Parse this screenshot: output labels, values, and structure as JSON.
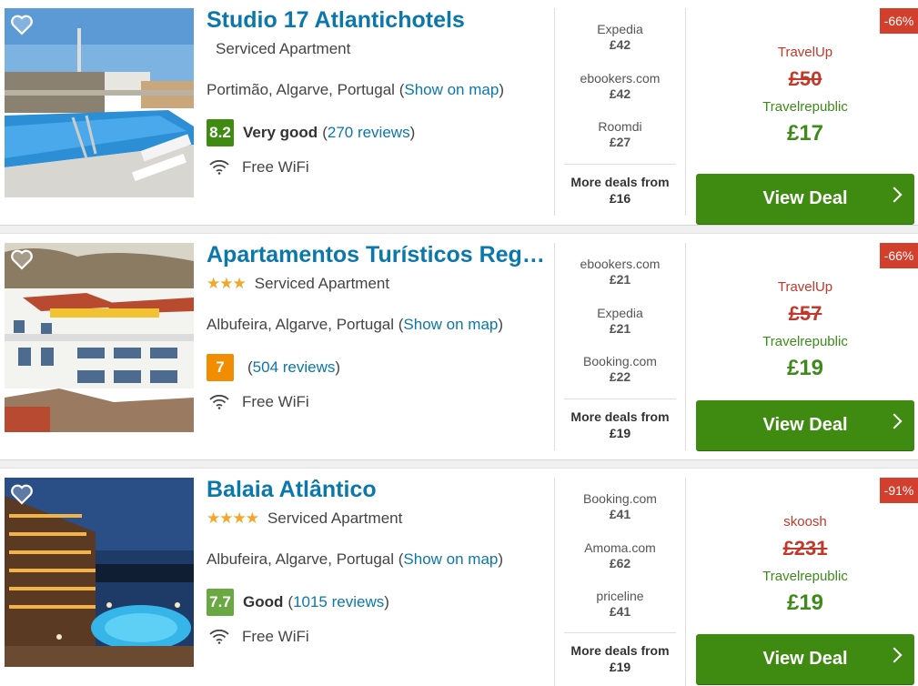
{
  "hotels": [
    {
      "name": "Studio 17 Atlantichotels",
      "stars": "",
      "type": "Serviced Apartment",
      "location": "Portimão, Algarve, Portugal",
      "map_open": "(",
      "map_link": "Show on map",
      "map_close": ")",
      "score": "8.2",
      "score_color": "#3f8b12",
      "rating_label": "Very good",
      "reviews_open": "(",
      "reviews_link": "270 reviews",
      "reviews_close": ")",
      "amenity": "Free WiFi",
      "deals": [
        {
          "provider": "Expedia",
          "price": "£42"
        },
        {
          "provider": "ebookers.com",
          "price": "£42"
        },
        {
          "provider": "Roomdi",
          "price": "£27"
        }
      ],
      "more_deals_label": "More deals from",
      "more_deals_price": "£16",
      "discount": "-66%",
      "old_provider": "TravelUp",
      "old_price": "£50",
      "best_provider": "Travelrepublic",
      "best_price": "£17",
      "cta": "View Deal"
    },
    {
      "name": "Apartamentos Turísticos Reg…",
      "stars": "★★★",
      "type": "Serviced Apartment",
      "location": "Albufeira, Algarve, Portugal",
      "map_open": "(",
      "map_link": "Show on map",
      "map_close": ")",
      "score": "7",
      "score_color": "#f28c00",
      "rating_label": "",
      "reviews_open": "(",
      "reviews_link": "504 reviews",
      "reviews_close": ")",
      "amenity": "Free WiFi",
      "deals": [
        {
          "provider": "ebookers.com",
          "price": "£21"
        },
        {
          "provider": "Expedia",
          "price": "£21"
        },
        {
          "provider": "Booking.com",
          "price": "£22"
        }
      ],
      "more_deals_label": "More deals from",
      "more_deals_price": "£19",
      "discount": "-66%",
      "old_provider": "TravelUp",
      "old_price": "£57",
      "best_provider": "Travelrepublic",
      "best_price": "£19",
      "cta": "View Deal"
    },
    {
      "name": "Balaia Atlântico",
      "stars": "★★★★",
      "type": "Serviced Apartment",
      "location": "Albufeira, Algarve, Portugal",
      "map_open": "(",
      "map_link": "Show on map",
      "map_close": ")",
      "score": "7.7",
      "score_color": "#6aa844",
      "rating_label": "Good",
      "reviews_open": "(",
      "reviews_link": "1015 reviews",
      "reviews_close": ")",
      "amenity": "Free WiFi",
      "deals": [
        {
          "provider": "Booking.com",
          "price": "£41"
        },
        {
          "provider": "Amoma.com",
          "price": "£62"
        },
        {
          "provider": "priceline",
          "price": "£41"
        }
      ],
      "more_deals_label": "More deals from",
      "more_deals_price": "£19",
      "discount": "-91%",
      "old_provider": "skoosh",
      "old_price": "£231",
      "best_provider": "Travelrepublic",
      "best_price": "£19",
      "cta": "View Deal"
    }
  ]
}
